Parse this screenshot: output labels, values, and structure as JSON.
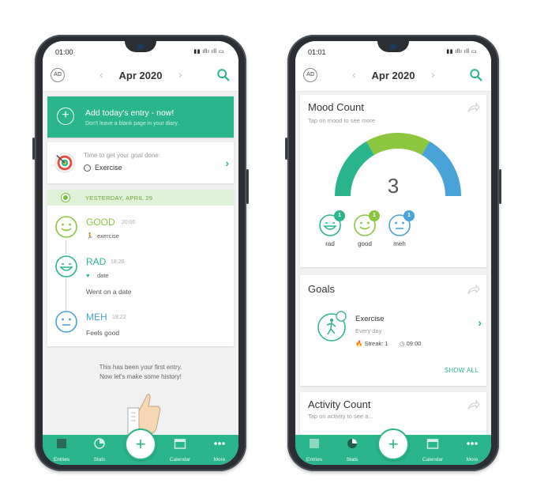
{
  "status": {
    "time": "01:00",
    "icons": "▮▮ ıllı ıll ▭"
  },
  "left": {
    "header": {
      "title": "Apr 2020",
      "logo": "AD"
    },
    "entry_banner": {
      "title": "Add today's entry - now!",
      "subtitle": "Don't leave a blank page in your diary."
    },
    "goal_prompt": {
      "text": "Time to get your goal done:",
      "goal": "Exercise"
    },
    "day": {
      "label": "YESTERDAY, APRIL 29",
      "entries": [
        {
          "mood": "GOOD",
          "time": "20:00",
          "activity": "exercise",
          "note": "",
          "color": "#8cc63f"
        },
        {
          "mood": "RAD",
          "time": "18:26",
          "activity": "date",
          "note": "Went on a date",
          "color": "#2bb58d"
        },
        {
          "mood": "MEH",
          "time": "18:22",
          "activity": "",
          "note": "Feels good",
          "color": "#4aa3d8"
        }
      ]
    },
    "empty_message": {
      "line1": "This has been your first entry.",
      "line2": "Now let's make some history!"
    }
  },
  "right": {
    "status_time": "01:01",
    "header": {
      "title": "Apr 2020",
      "logo": "AD"
    },
    "mood_count": {
      "title": "Mood Count",
      "subtitle": "Tap on mood to see more",
      "total": "3",
      "moods": [
        {
          "label": "rad",
          "count": "1",
          "color": "#2bb58d"
        },
        {
          "label": "good",
          "count": "1",
          "color": "#8cc63f"
        },
        {
          "label": "meh",
          "count": "1",
          "color": "#4aa3d8"
        }
      ]
    },
    "goals": {
      "title": "Goals",
      "name": "Exercise",
      "frequency": "Every day",
      "streak": "Streak: 1",
      "time": "09:00",
      "show_all": "SHOW ALL"
    },
    "activity_count": {
      "title": "Activity Count",
      "subtitle": "Tap on activity to see a..."
    }
  },
  "nav": {
    "items": [
      {
        "label": "Entries",
        "icon": "entries-icon"
      },
      {
        "label": "Stats",
        "icon": "stats-icon"
      },
      {
        "label": "Calendar",
        "icon": "calendar-icon"
      },
      {
        "label": "More",
        "icon": "more-icon"
      }
    ],
    "fab": "+"
  },
  "colors": {
    "accent": "#2bb58d",
    "good": "#8cc63f",
    "meh": "#4aa3d8"
  }
}
